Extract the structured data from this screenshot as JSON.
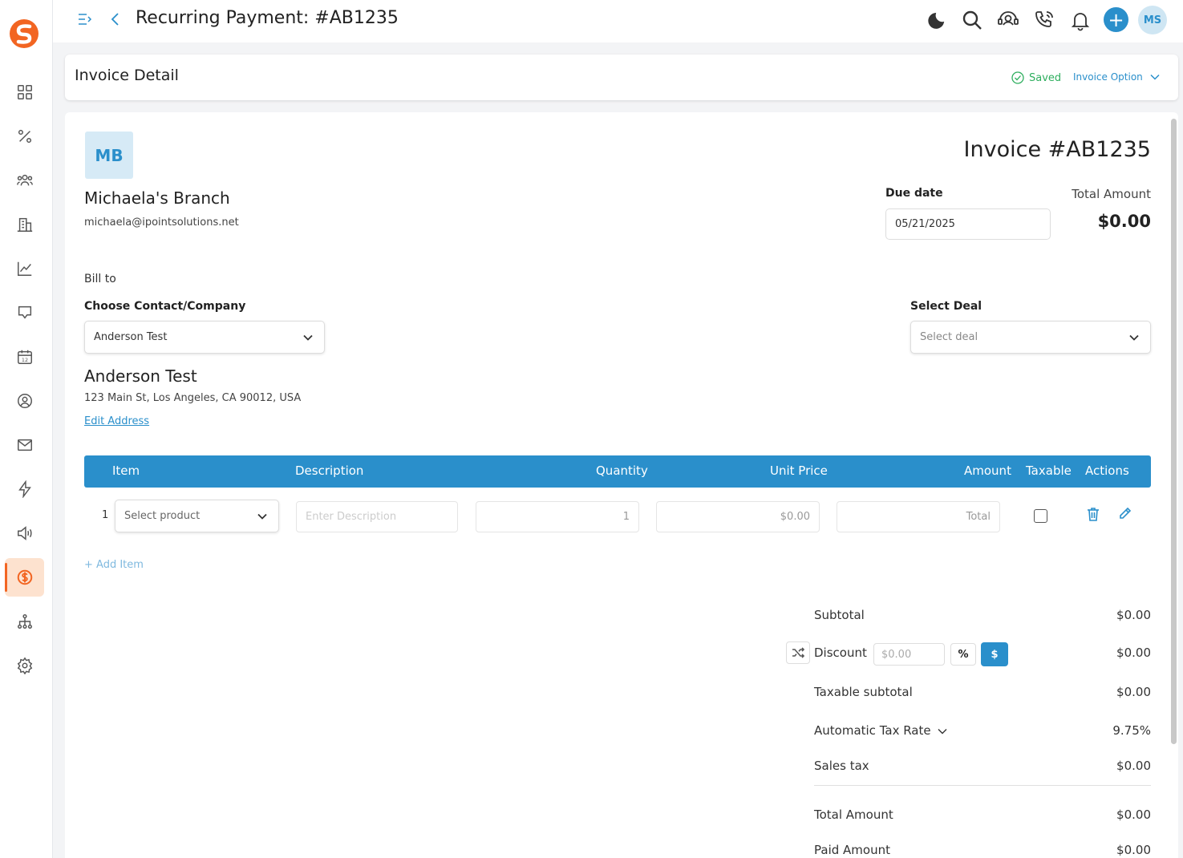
{
  "header": {
    "title": "Recurring Payment: #AB1235",
    "avatar_initials": "MS"
  },
  "sidebar": {
    "items": [
      {
        "icon": "dashboard-icon"
      },
      {
        "icon": "percent-icon"
      },
      {
        "icon": "contacts-icon"
      },
      {
        "icon": "companies-icon"
      },
      {
        "icon": "analytics-icon"
      },
      {
        "icon": "feedback-icon"
      },
      {
        "icon": "calendar-icon"
      },
      {
        "icon": "user-circle-icon"
      },
      {
        "icon": "mail-icon"
      },
      {
        "icon": "automation-icon"
      },
      {
        "icon": "campaign-icon"
      },
      {
        "icon": "payments-icon",
        "active": true
      },
      {
        "icon": "workflow-icon"
      },
      {
        "icon": "settings-icon"
      }
    ]
  },
  "detail_bar": {
    "title": "Invoice Detail",
    "saved_label": "Saved",
    "option_label": "Invoice Option"
  },
  "invoice": {
    "branch_initials": "MB",
    "branch_name": "Michaela's Branch",
    "branch_email": "michaela@ipointsolutions.net",
    "number": "Invoice #AB1235",
    "due_date_label": "Due date",
    "due_date": "05/21/2025",
    "total_amount_label": "Total Amount",
    "total_amount": "$0.00",
    "bill_to_label": "Bill to",
    "choose_contact_label": "Choose Contact/Company",
    "contact_value": "Anderson Test",
    "select_deal_label": "Select Deal",
    "select_deal_placeholder": "Select deal",
    "contact_name": "Anderson Test",
    "contact_address": "123 Main St, Los Angeles, CA 90012, USA",
    "edit_address_label": "Edit Address"
  },
  "table": {
    "columns": [
      "Item",
      "Description",
      "Quantity",
      "Unit Price",
      "Amount",
      "Taxable",
      "Actions"
    ],
    "rows": [
      {
        "num": "1",
        "product_placeholder": "Select product",
        "description_placeholder": "Enter Description",
        "quantity": "1",
        "unit_price": "$0.00",
        "amount_placeholder": "Total",
        "taxable": false
      }
    ],
    "add_item_label": "+ Add Item"
  },
  "summary": {
    "subtotal_label": "Subtotal",
    "subtotal": "$0.00",
    "discount_label": "Discount",
    "discount_placeholder": "$0.00",
    "discount_pct_label": "%",
    "discount_dollar_label": "$",
    "discount": "$0.00",
    "taxable_subtotal_label": "Taxable subtotal",
    "taxable_subtotal": "$0.00",
    "tax_rate_label": "Automatic Tax Rate",
    "tax_rate": "9.75%",
    "sales_tax_label": "Sales tax",
    "sales_tax": "$0.00",
    "total_label": "Total Amount",
    "total": "$0.00",
    "paid_label": "Paid Amount",
    "paid": "$0.00"
  },
  "colors": {
    "accent": "#2a8fcb",
    "brand": "#f26522",
    "success": "#2eae5e"
  }
}
